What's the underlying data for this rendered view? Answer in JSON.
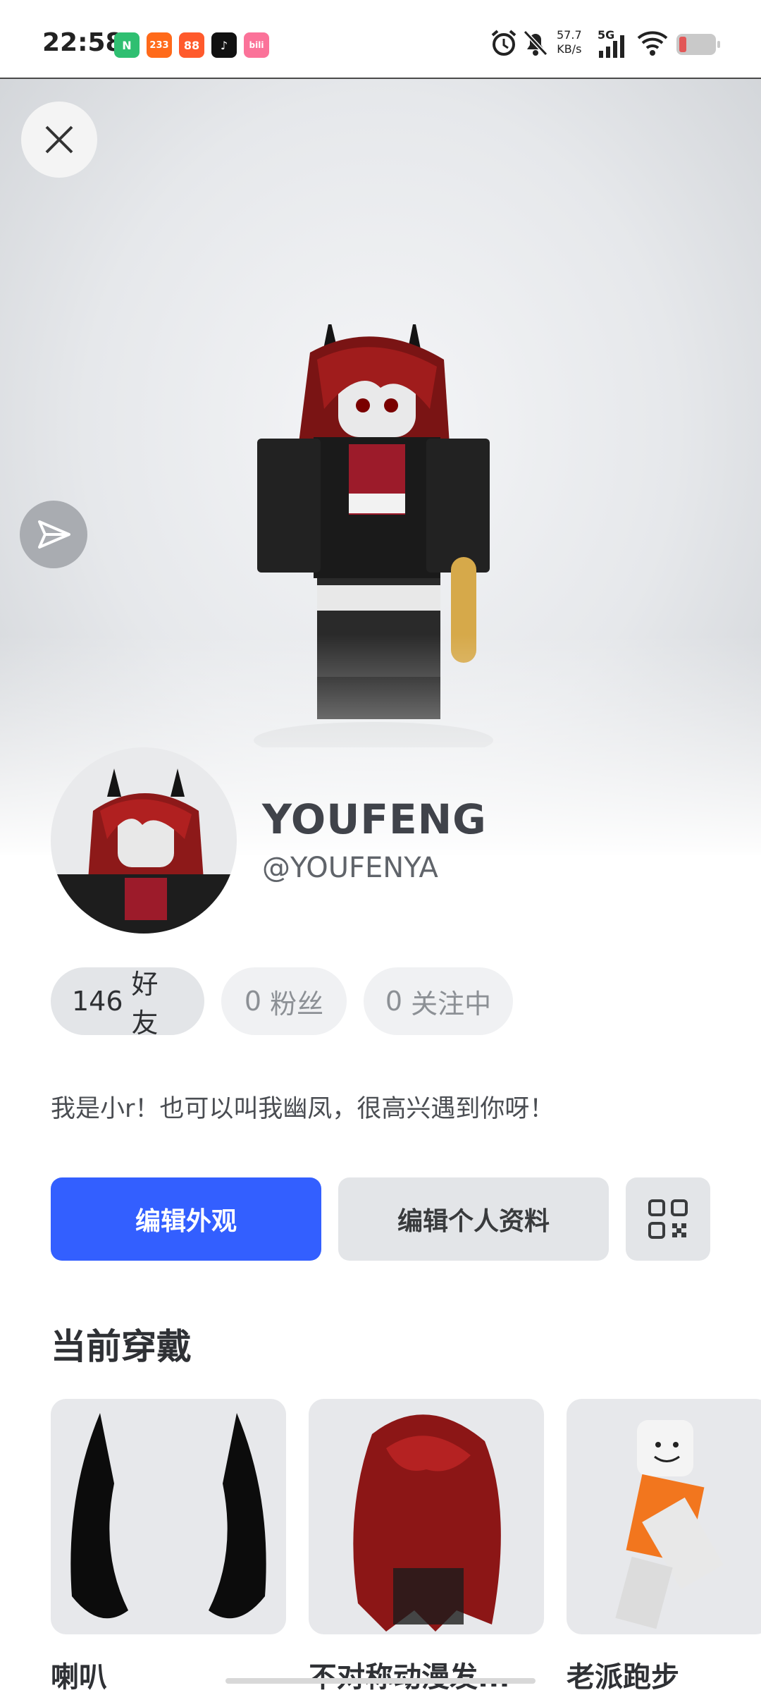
{
  "status_bar": {
    "time": "22:58",
    "apps": [
      {
        "name": "green-app-icon",
        "text": "N",
        "color": "#2fbf71"
      },
      {
        "name": "233-app-icon",
        "text": "233",
        "color": "#ff6a1a"
      },
      {
        "name": "orange-app-icon",
        "text": "88",
        "color": "#ff5a2c"
      },
      {
        "name": "tiktok-app-icon",
        "text": "♪",
        "color": "#111111"
      },
      {
        "name": "bilibili-app-icon",
        "text": "bili",
        "color": "#fb7299"
      }
    ],
    "net_speed_value": "57.7",
    "net_speed_unit": "KB/s",
    "network": "5G"
  },
  "hero": {
    "close_icon": "close-icon",
    "share_icon": "share-icon"
  },
  "profile": {
    "display_name": "YOUFENG",
    "username": "@YOUFENYA",
    "bio": "我是小r！也可以叫我幽凤，很高兴遇到你呀！"
  },
  "stats": {
    "friends_count": "146",
    "friends_label": "好友",
    "followers_count": "0",
    "followers_label": "粉丝",
    "following_count": "0",
    "following_label": "关注中"
  },
  "actions": {
    "edit_avatar": "编辑外观",
    "edit_profile": "编辑个人资料",
    "qr_icon": "qr-code-icon"
  },
  "wearing": {
    "title": "当前穿戴",
    "items": [
      {
        "label": "喇叭"
      },
      {
        "label": "不对称动漫发..."
      },
      {
        "label": "老派跑步"
      }
    ]
  },
  "colors": {
    "primary": "#335fff",
    "secondary_button": "#e3e5e8"
  }
}
